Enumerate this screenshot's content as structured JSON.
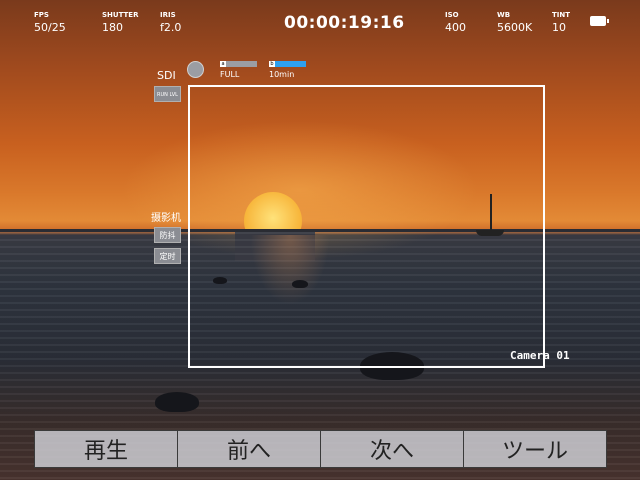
{
  "hud": {
    "fps": {
      "label": "FPS",
      "value": "50/25"
    },
    "shutter": {
      "label": "SHUTTER",
      "value": "180"
    },
    "iris": {
      "label": "IRIS",
      "value": "f2.0"
    },
    "timecode": "00:00:19:16",
    "iso": {
      "label": "ISO",
      "value": "400"
    },
    "wb": {
      "label": "WB",
      "value": "5600K"
    },
    "tint": {
      "label": "TINT",
      "value": "10"
    },
    "battery_icon": "battery-icon"
  },
  "recording": {
    "output": "SDI",
    "media_a": {
      "tag": "a",
      "status": "FULL"
    },
    "media_b": {
      "tag": "b",
      "remaining": "10min"
    }
  },
  "side": {
    "mode_label": "摄影机",
    "btn_top": "RUN LVL",
    "btn_mode1": "防抖",
    "btn_mode2": "定时"
  },
  "camera_name": "Camera 01",
  "bottom": {
    "play": "再生",
    "prev": "前へ",
    "next": "次へ",
    "tools": "ツール"
  },
  "colors": {
    "media_b_accent": "#2ea0f0",
    "media_a_bar": "#9b9da3"
  }
}
